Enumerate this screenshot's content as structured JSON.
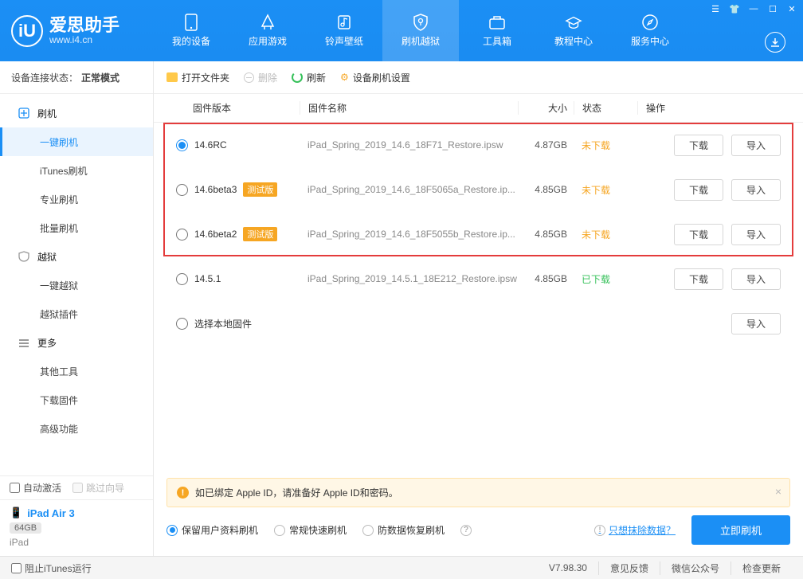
{
  "brand": {
    "title": "爱思助手",
    "sub": "www.i4.cn"
  },
  "nav": [
    "我的设备",
    "应用游戏",
    "铃声壁纸",
    "刷机越狱",
    "工具箱",
    "教程中心",
    "服务中心"
  ],
  "conn": {
    "label": "设备连接状态：",
    "value": "正常模式"
  },
  "sidebar": {
    "flash": "刷机",
    "flash_items": [
      "一键刷机",
      "iTunes刷机",
      "专业刷机",
      "批量刷机"
    ],
    "jb": "越狱",
    "jb_items": [
      "一键越狱",
      "越狱插件"
    ],
    "more": "更多",
    "more_items": [
      "其他工具",
      "下载固件",
      "高级功能"
    ],
    "auto_activate": "自动激活",
    "skip_guide": "跳过向导"
  },
  "device": {
    "name": "iPad Air 3",
    "storage": "64GB",
    "model": "iPad"
  },
  "toolbar": {
    "open": "打开文件夹",
    "del": "删除",
    "refresh": "刷新",
    "settings": "设备刷机设置"
  },
  "columns": {
    "version": "固件版本",
    "name": "固件名称",
    "size": "大小",
    "status": "状态",
    "ops": "操作"
  },
  "rows": [
    {
      "version": "14.6RC",
      "beta": false,
      "name": "iPad_Spring_2019_14.6_18F71_Restore.ipsw",
      "size": "4.87GB",
      "status": "未下载",
      "downloaded": false,
      "ops": [
        "下载",
        "导入"
      ]
    },
    {
      "version": "14.6beta3",
      "beta": true,
      "name": "iPad_Spring_2019_14.6_18F5065a_Restore.ip...",
      "size": "4.85GB",
      "status": "未下载",
      "downloaded": false,
      "ops": [
        "下载",
        "导入"
      ]
    },
    {
      "version": "14.6beta2",
      "beta": true,
      "name": "iPad_Spring_2019_14.6_18F5055b_Restore.ip...",
      "size": "4.85GB",
      "status": "未下载",
      "downloaded": false,
      "ops": [
        "下载",
        "导入"
      ]
    },
    {
      "version": "14.5.1",
      "beta": false,
      "name": "iPad_Spring_2019_14.5.1_18E212_Restore.ipsw",
      "size": "4.85GB",
      "status": "已下载",
      "downloaded": true,
      "ops": [
        "下载",
        "导入"
      ]
    }
  ],
  "local_row": {
    "label": "选择本地固件",
    "import": "导入"
  },
  "beta_tag": "测试版",
  "notice": "如已绑定 Apple ID，请准备好 Apple ID和密码。",
  "flash_opts": [
    "保留用户资料刷机",
    "常规快速刷机",
    "防数据恢复刷机"
  ],
  "erase_link": "只想抹除数据？",
  "flash_btn": "立即刷机",
  "status": {
    "block_itunes": "阻止iTunes运行",
    "version": "V7.98.30",
    "feedback": "意见反馈",
    "wechat": "微信公众号",
    "update": "检查更新"
  }
}
